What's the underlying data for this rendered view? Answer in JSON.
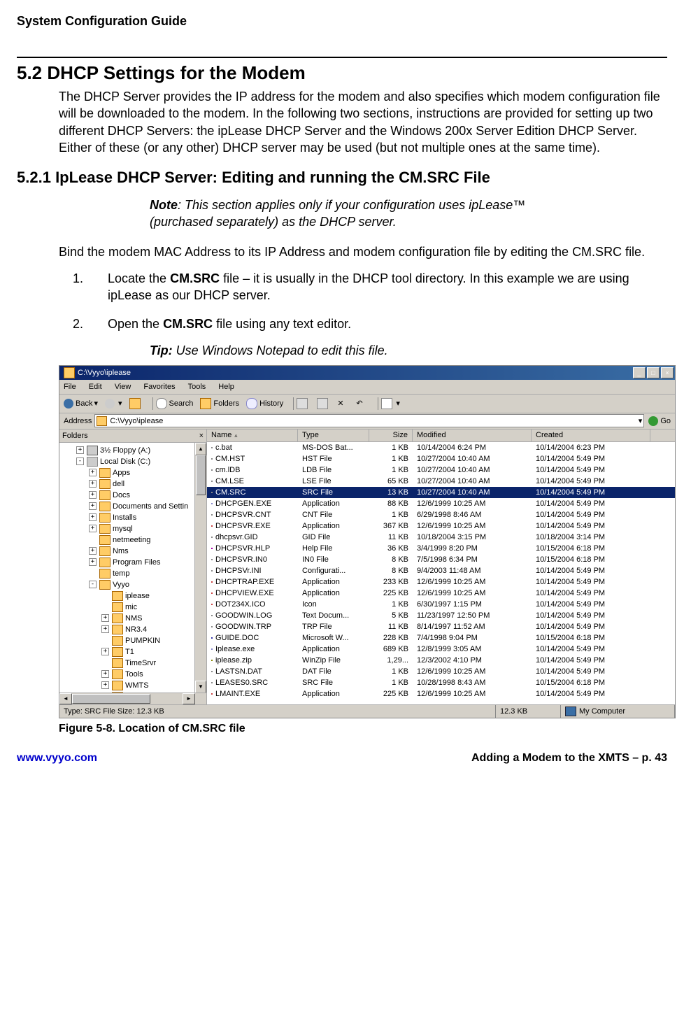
{
  "header": {
    "guide_title": "System Configuration Guide"
  },
  "section": {
    "num": "5.2",
    "title": "DHCP Settings for the Modem",
    "intro": "The DHCP Server provides the IP address for the modem and also specifies which modem configuration file will be downloaded to the modem.  In the following two sections, instructions are provided for setting up two different DHCP Servers:  the ipLease DHCP Server and the Windows 200x Server Edition DHCP Server.  Either of these (or any other) DHCP server may be used (but not multiple ones at the same time)."
  },
  "subsection": {
    "num": "5.2.1",
    "title": "IpLease DHCP Server: Editing and running the CM.SRC File",
    "note_label": "Note",
    "note_text": ": This section applies only if your configuration uses ipLease™  (purchased separately) as the DHCP server.",
    "instr": "Bind the modem MAC Address to its IP Address and modem configuration file by editing the CM.SRC file.",
    "step1_pre": "Locate the ",
    "step1_bold": "CM.SRC",
    "step1_post": " file – it is usually in the DHCP tool directory. In this example we are using ipLease as our DHCP server.",
    "step2_pre": "Open the ",
    "step2_bold": "CM.SRC",
    "step2_post": " file using any text editor.",
    "tip_label": "Tip:",
    "tip_text": " Use Windows Notepad to edit this file."
  },
  "screenshot": {
    "title": "C:\\Vyyo\\iplease",
    "menu": [
      "File",
      "Edit",
      "View",
      "Favorites",
      "Tools",
      "Help"
    ],
    "toolbar": {
      "back": "Back",
      "search": "Search",
      "folders": "Folders",
      "history": "History"
    },
    "address_label": "Address",
    "address_value": "C:\\Vyyo\\iplease",
    "go": "Go",
    "folders_label": "Folders",
    "tree": [
      {
        "depth": 1,
        "exp": "+",
        "icon": "floppy",
        "label": "3½ Floppy (A:)"
      },
      {
        "depth": 1,
        "exp": "-",
        "icon": "drive",
        "label": "Local Disk (C:)"
      },
      {
        "depth": 2,
        "exp": "+",
        "icon": "folder",
        "label": "Apps"
      },
      {
        "depth": 2,
        "exp": "+",
        "icon": "folder",
        "label": "dell"
      },
      {
        "depth": 2,
        "exp": "+",
        "icon": "folder",
        "label": "Docs"
      },
      {
        "depth": 2,
        "exp": "+",
        "icon": "folder",
        "label": "Documents and Settin"
      },
      {
        "depth": 2,
        "exp": "+",
        "icon": "folder",
        "label": "Installs"
      },
      {
        "depth": 2,
        "exp": "+",
        "icon": "folder",
        "label": "mysql"
      },
      {
        "depth": 2,
        "exp": "",
        "icon": "folder",
        "label": "netmeeting"
      },
      {
        "depth": 2,
        "exp": "+",
        "icon": "folder",
        "label": "Nms"
      },
      {
        "depth": 2,
        "exp": "+",
        "icon": "folder",
        "label": "Program Files"
      },
      {
        "depth": 2,
        "exp": "",
        "icon": "folder",
        "label": "temp"
      },
      {
        "depth": 2,
        "exp": "-",
        "icon": "folder",
        "label": "Vyyo"
      },
      {
        "depth": 3,
        "exp": "",
        "icon": "folder",
        "label": "iplease"
      },
      {
        "depth": 3,
        "exp": "",
        "icon": "folder",
        "label": "mic"
      },
      {
        "depth": 3,
        "exp": "+",
        "icon": "folder",
        "label": "NMS"
      },
      {
        "depth": 3,
        "exp": "+",
        "icon": "folder",
        "label": "NR3.4"
      },
      {
        "depth": 3,
        "exp": "",
        "icon": "folder",
        "label": "PUMPKIN"
      },
      {
        "depth": 3,
        "exp": "+",
        "icon": "folder",
        "label": "T1"
      },
      {
        "depth": 3,
        "exp": "",
        "icon": "folder",
        "label": "TimeSrvr"
      },
      {
        "depth": 3,
        "exp": "+",
        "icon": "folder",
        "label": "Tools"
      },
      {
        "depth": 3,
        "exp": "+",
        "icon": "folder",
        "label": "WMTS"
      },
      {
        "depth": 3,
        "exp": "+",
        "icon": "folder",
        "label": "Wmu"
      }
    ],
    "columns": {
      "name": "Name",
      "type": "Type",
      "size": "Size",
      "modified": "Modified",
      "created": "Created"
    },
    "files": [
      {
        "ico": "bat",
        "name": "c.bat",
        "type": "MS-DOS Bat...",
        "size": "1 KB",
        "modified": "10/14/2004 6:24 PM",
        "created": "10/14/2004 6:23 PM"
      },
      {
        "ico": "hst",
        "name": "CM.HST",
        "type": "HST File",
        "size": "1 KB",
        "modified": "10/27/2004 10:40 AM",
        "created": "10/14/2004 5:49 PM"
      },
      {
        "ico": "hst",
        "name": "cm.lDB",
        "type": "LDB File",
        "size": "1 KB",
        "modified": "10/27/2004 10:40 AM",
        "created": "10/14/2004 5:49 PM"
      },
      {
        "ico": "hst",
        "name": "CM.LSE",
        "type": "LSE File",
        "size": "65 KB",
        "modified": "10/27/2004 10:40 AM",
        "created": "10/14/2004 5:49 PM"
      },
      {
        "ico": "hst",
        "name": "CM.SRC",
        "type": "SRC File",
        "size": "13 KB",
        "modified": "10/27/2004 10:40 AM",
        "created": "10/14/2004 5:49 PM",
        "selected": true
      },
      {
        "ico": "app",
        "name": "DHCPGEN.EXE",
        "type": "Application",
        "size": "88 KB",
        "modified": "12/6/1999 10:25 AM",
        "created": "10/14/2004 5:49 PM"
      },
      {
        "ico": "hst",
        "name": "DHCPSVR.CNT",
        "type": "CNT File",
        "size": "1 KB",
        "modified": "6/29/1998 8:46 AM",
        "created": "10/14/2004 5:49 PM"
      },
      {
        "ico": "app34",
        "name": "DHCPSVR.EXE",
        "type": "Application",
        "size": "367 KB",
        "modified": "12/6/1999 10:25 AM",
        "created": "10/14/2004 5:49 PM"
      },
      {
        "ico": "hst",
        "name": "dhcpsvr.GID",
        "type": "GID File",
        "size": "11 KB",
        "modified": "10/18/2004 3:15 PM",
        "created": "10/18/2004 3:14 PM"
      },
      {
        "ico": "hlp",
        "name": "DHCPSVR.HLP",
        "type": "Help File",
        "size": "36 KB",
        "modified": "3/4/1999 8:20 PM",
        "created": "10/15/2004 6:18 PM"
      },
      {
        "ico": "hst",
        "name": "DHCPSVR.IN0",
        "type": "IN0 File",
        "size": "8 KB",
        "modified": "7/5/1998 6:34 PM",
        "created": "10/15/2004 6:18 PM"
      },
      {
        "ico": "ini",
        "name": "DHCPSVr.INI",
        "type": "Configurati...",
        "size": "8 KB",
        "modified": "9/4/2003 11:48 AM",
        "created": "10/14/2004 5:49 PM"
      },
      {
        "ico": "app34",
        "name": "DHCPTRAP.EXE",
        "type": "Application",
        "size": "233 KB",
        "modified": "12/6/1999 10:25 AM",
        "created": "10/14/2004 5:49 PM"
      },
      {
        "ico": "app34",
        "name": "DHCPVIEW.EXE",
        "type": "Application",
        "size": "225 KB",
        "modified": "12/6/1999 10:25 AM",
        "created": "10/14/2004 5:49 PM"
      },
      {
        "ico": "app34",
        "name": "DOT234X.ICO",
        "type": "Icon",
        "size": "1 KB",
        "modified": "6/30/1997 1:15 PM",
        "created": "10/14/2004 5:49 PM"
      },
      {
        "ico": "ini",
        "name": "GOODWIN.LOG",
        "type": "Text Docum...",
        "size": "5 KB",
        "modified": "11/23/1997 12:50 PM",
        "created": "10/14/2004 5:49 PM"
      },
      {
        "ico": "hst",
        "name": "GOODWIN.TRP",
        "type": "TRP File",
        "size": "11 KB",
        "modified": "8/14/1997 11:52 AM",
        "created": "10/14/2004 5:49 PM"
      },
      {
        "ico": "word",
        "name": "GUIDE.DOC",
        "type": "Microsoft W...",
        "size": "228 KB",
        "modified": "7/4/1998 9:04 PM",
        "created": "10/15/2004 6:18 PM"
      },
      {
        "ico": "app",
        "name": "Iplease.exe",
        "type": "Application",
        "size": "689 KB",
        "modified": "12/8/1999 3:05 AM",
        "created": "10/14/2004 5:49 PM"
      },
      {
        "ico": "zip",
        "name": "iplease.zip",
        "type": "WinZip File",
        "size": "1,29...",
        "modified": "12/3/2002 4:10 PM",
        "created": "10/14/2004 5:49 PM"
      },
      {
        "ico": "hst",
        "name": "LASTSN.DAT",
        "type": "DAT File",
        "size": "1 KB",
        "modified": "12/6/1999 10:25 AM",
        "created": "10/14/2004 5:49 PM"
      },
      {
        "ico": "hst",
        "name": "LEASES0.SRC",
        "type": "SRC File",
        "size": "1 KB",
        "modified": "10/28/1998 8:43 AM",
        "created": "10/15/2004 6:18 PM"
      },
      {
        "ico": "app34",
        "name": "LMAINT.EXE",
        "type": "Application",
        "size": "225 KB",
        "modified": "12/6/1999 10:25 AM",
        "created": "10/14/2004 5:49 PM"
      }
    ],
    "status": {
      "type": "Type: SRC File Size: 12.3 KB",
      "size": "12.3 KB",
      "zone": "My Computer"
    }
  },
  "figure_caption": "Figure 5-8. Location of CM.SRC file",
  "footer": {
    "url": "www.vyyo.com",
    "page": "Adding a Modem to the XMTS – p. 43"
  }
}
